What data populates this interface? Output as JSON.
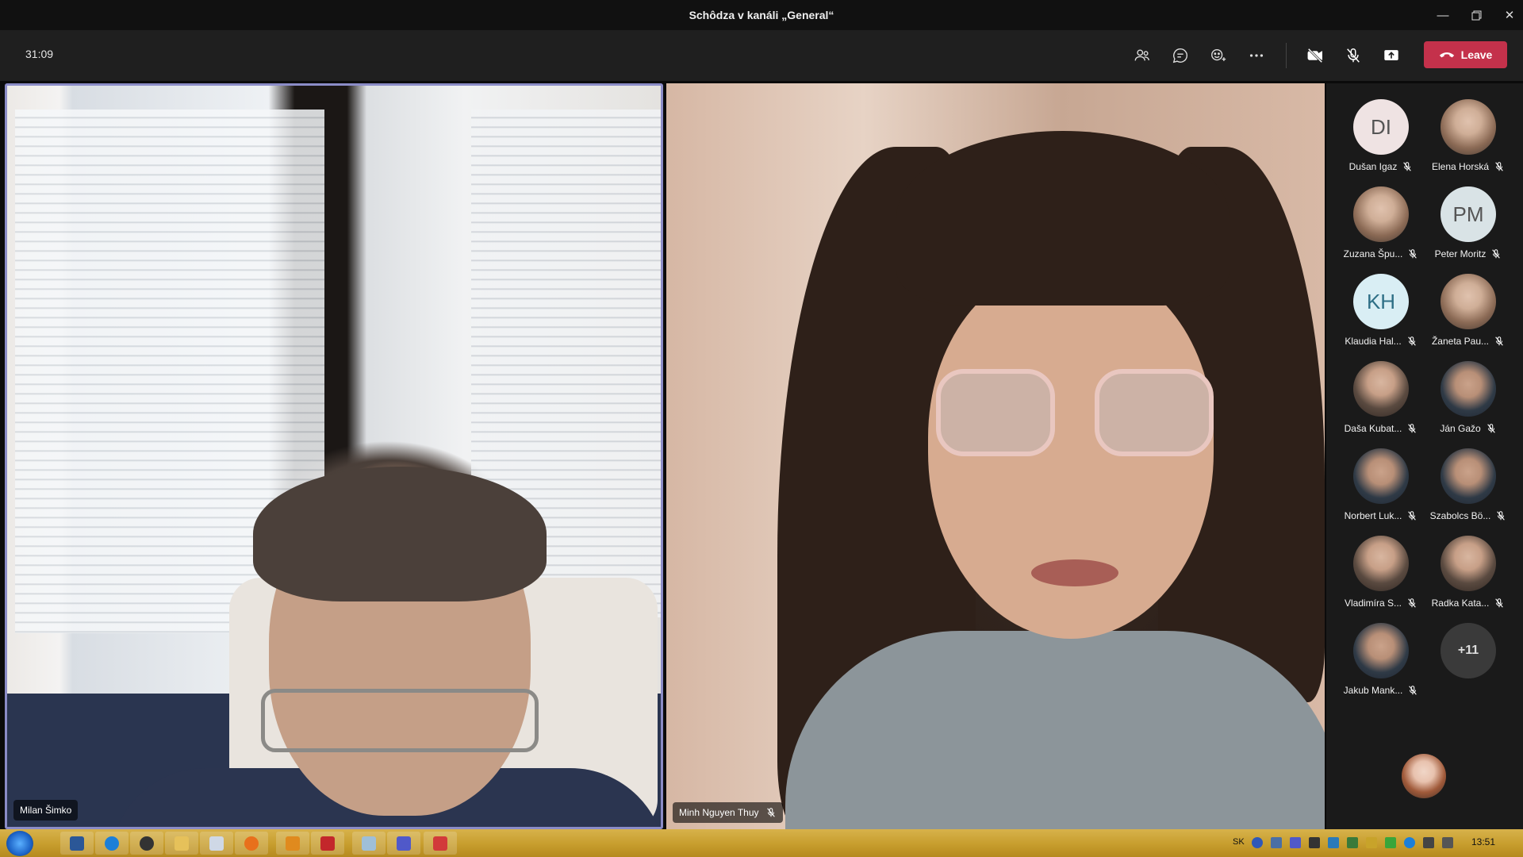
{
  "window": {
    "title": "Schôdza v kanáli „General“"
  },
  "toolbar": {
    "timer": "31:09",
    "leave_label": "Leave",
    "leave_color": "#c4314b",
    "icons": [
      "people-icon",
      "chat-icon",
      "reactions-icon",
      "more-icon",
      "camera-off-icon",
      "mic-off-icon",
      "share-screen-icon",
      "phone-icon"
    ]
  },
  "tiles": [
    {
      "name": "Milan Šimko",
      "muted": false
    },
    {
      "name": "Minh Nguyen Thuy",
      "muted": true
    }
  ],
  "participants": [
    {
      "name": "Dušan Igaz",
      "initials": "DI",
      "muted": true
    },
    {
      "name": "Elena Horská",
      "initials": "",
      "muted": true
    },
    {
      "name": "Zuzana Špu...",
      "initials": "",
      "muted": true
    },
    {
      "name": "Peter Moritz",
      "initials": "PM",
      "muted": true
    },
    {
      "name": "Klaudia Hal...",
      "initials": "KH",
      "muted": true
    },
    {
      "name": "Žaneta Pau...",
      "initials": "",
      "muted": true
    },
    {
      "name": "Daša Kubat...",
      "initials": "",
      "muted": true
    },
    {
      "name": "Ján Gažo",
      "initials": "",
      "muted": true
    },
    {
      "name": "Norbert Luk...",
      "initials": "",
      "muted": true
    },
    {
      "name": "Szabolcs Bö...",
      "initials": "",
      "muted": true
    },
    {
      "name": "Vladimíra S...",
      "initials": "",
      "muted": true
    },
    {
      "name": "Radka Kata...",
      "initials": "",
      "muted": true
    },
    {
      "name": "Jakub Mank...",
      "initials": "",
      "muted": true
    }
  ],
  "more_participants": "+11",
  "taskbar": {
    "language": "SK",
    "clock": "13:51"
  }
}
